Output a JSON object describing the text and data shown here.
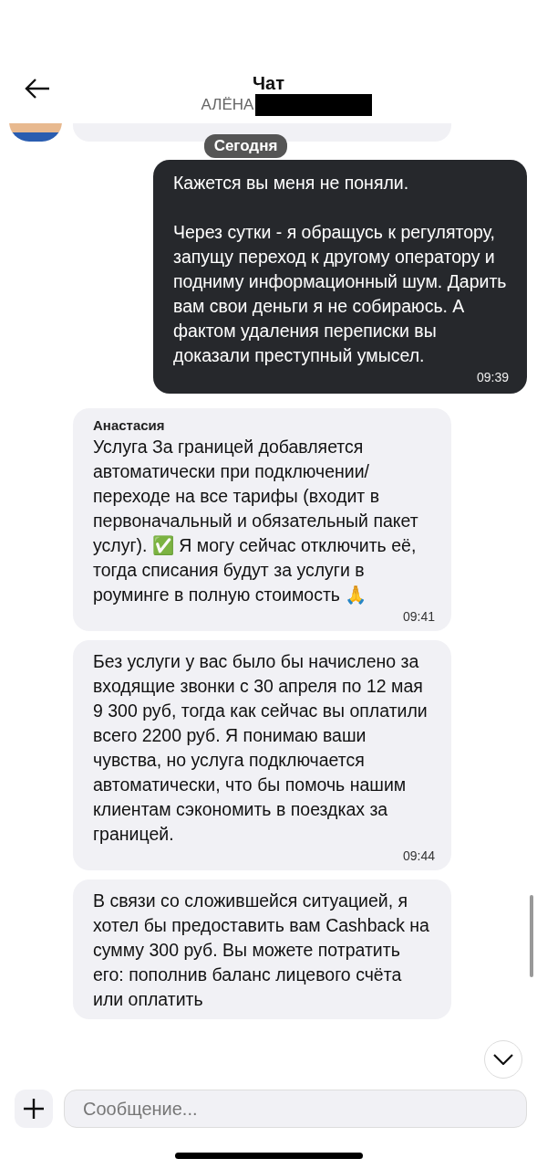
{
  "header": {
    "title": "Чат",
    "subtitle": "АЛЁНА"
  },
  "date_divider": "Сегодня",
  "messages": [
    {
      "kind": "outgoing",
      "text": "Кажется вы меня не поняли.\n\nЧерез сутки - я обращусь к регулятору, запущу переход к другому оператору и подниму информационный шум. Дарить вам свои деньги я не собираюсь. А фактом удаления переписки вы доказали преступный умысел.",
      "time": "09:39"
    },
    {
      "kind": "incoming",
      "sender": "Анастасия",
      "text": "Услуга За границей добавляется автоматически при подключении/ переходе на все тарифы (входит в первоначальный и обязательный пакет услуг). ✅ Я могу сейчас отключить её, тогда списания будут за услуги в роуминге в полную стоимость 🙏",
      "time": "09:41"
    },
    {
      "kind": "incoming",
      "text": "Без услуги у вас было бы начислено за входящие звонки с 30 апреля по 12 мая 9 300 руб, тогда как сейчас вы оплатили всего 2200 руб. Я понимаю ваши чувства, но услуга подключается автоматически, что бы помочь нашим клиентам сэкономить в поездках за границей.",
      "time": "09:44"
    },
    {
      "kind": "incoming",
      "text": "В связи со сложившейся ситуацией, я хотел бы предоставить вам Cashback на сумму 300 руб. Вы можете потратить его: пополнив баланс лицевого счёта или оплатить"
    }
  ],
  "composer": {
    "placeholder": "Сообщение..."
  }
}
